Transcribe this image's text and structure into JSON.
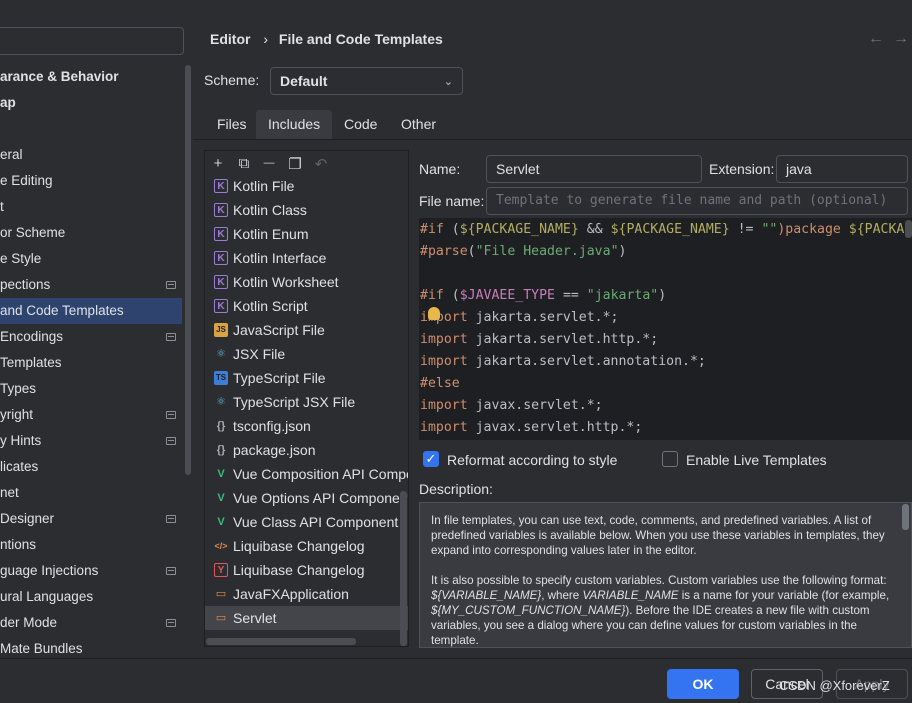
{
  "header": {
    "breadcrumb_root": "Editor",
    "breadcrumb_sep": "›",
    "breadcrumb_page": "File and Code Templates",
    "back_arrow": "←",
    "forward_arrow": "→"
  },
  "sidebar": {
    "items": [
      {
        "label": "arance & Behavior",
        "bold": true
      },
      {
        "label": "ap",
        "bold": true
      },
      {
        "label": ""
      },
      {
        "label": "eral"
      },
      {
        "label": "e Editing"
      },
      {
        "label": "t"
      },
      {
        "label": "or Scheme"
      },
      {
        "label": "e Style"
      },
      {
        "label": "pections",
        "badge": true
      },
      {
        "label": " and Code Templates",
        "selected": true
      },
      {
        "label": "Encodings",
        "badge": true
      },
      {
        "label": " Templates"
      },
      {
        "label": "Types"
      },
      {
        "label": "yright",
        "badge": true
      },
      {
        "label": "y Hints",
        "badge": true
      },
      {
        "label": "licates"
      },
      {
        "label": "net"
      },
      {
        "label": " Designer",
        "badge": true
      },
      {
        "label": "ntions"
      },
      {
        "label": "guage Injections",
        "badge": true
      },
      {
        "label": "ural Languages"
      },
      {
        "label": "der Mode",
        "badge": true
      },
      {
        "label": "Mate Bundles"
      }
    ]
  },
  "scheme": {
    "label": "Scheme:",
    "value": "Default"
  },
  "tabs": [
    {
      "label": "Files"
    },
    {
      "label": "Includes",
      "active": true
    },
    {
      "label": "Code"
    },
    {
      "label": "Other"
    }
  ],
  "toolbar": {
    "add": "+",
    "copy": "⧉",
    "remove": "—",
    "duplicate": "❐",
    "reset": "↶"
  },
  "templates": [
    {
      "label": "Kotlin File",
      "icon": "kotlin-icon",
      "glyph": "K",
      "color": "#9d7cd8"
    },
    {
      "label": "Kotlin Class",
      "icon": "kotlin-icon",
      "glyph": "K",
      "color": "#9d7cd8"
    },
    {
      "label": "Kotlin Enum",
      "icon": "kotlin-icon",
      "glyph": "K",
      "color": "#9d7cd8"
    },
    {
      "label": "Kotlin Interface",
      "icon": "kotlin-icon",
      "glyph": "K",
      "color": "#9d7cd8"
    },
    {
      "label": "Kotlin Worksheet",
      "icon": "kotlin-icon",
      "glyph": "K",
      "color": "#9d7cd8"
    },
    {
      "label": "Kotlin Script",
      "icon": "kotlin-icon",
      "glyph": "K",
      "color": "#9d7cd8"
    },
    {
      "label": "JavaScript File",
      "icon": "javascript-icon",
      "glyph": "JS",
      "color": "#d9a343"
    },
    {
      "label": "JSX File",
      "icon": "react-icon",
      "glyph": "⚛",
      "color": "#6fb7e3"
    },
    {
      "label": "TypeScript File",
      "icon": "typescript-icon",
      "glyph": "TS",
      "color": "#3c7fd8"
    },
    {
      "label": "TypeScript JSX File",
      "icon": "react-icon",
      "glyph": "⚛",
      "color": "#6fb7e3"
    },
    {
      "label": "tsconfig.json",
      "icon": "json-icon",
      "glyph": "{}",
      "color": "#a8adb3"
    },
    {
      "label": "package.json",
      "icon": "json-icon",
      "glyph": "{}",
      "color": "#a8adb3"
    },
    {
      "label": "Vue Composition API Compo",
      "icon": "vue-icon",
      "glyph": "V",
      "color": "#42b883"
    },
    {
      "label": "Vue Options API Component",
      "icon": "vue-icon",
      "glyph": "V",
      "color": "#42b883"
    },
    {
      "label": "Vue Class API Component",
      "icon": "vue-icon",
      "glyph": "V",
      "color": "#42b883"
    },
    {
      "label": "Liquibase Changelog",
      "icon": "xml-icon",
      "glyph": "</>",
      "color": "#e08b4f"
    },
    {
      "label": "Liquibase Changelog",
      "icon": "yaml-icon",
      "glyph": "Y",
      "color": "#e0575a"
    },
    {
      "label": "JavaFXApplication",
      "icon": "java-file-icon",
      "glyph": "▭",
      "color": "#e08b4f"
    },
    {
      "label": "Servlet",
      "icon": "java-file-icon",
      "glyph": "▭",
      "color": "#e08b4f",
      "selected": true
    }
  ],
  "form": {
    "name_label": "Name:",
    "name_value": "Servlet",
    "extension_label": "Extension:",
    "extension_value": "java",
    "filename_label": "File name:",
    "filename_placeholder": "Template to generate file name and path (optional)"
  },
  "code_lines": [
    [
      {
        "t": "#if",
        "c": "kw"
      },
      {
        "t": " ("
      },
      {
        "t": "${PACKAGE_NAME}",
        "c": "dir"
      },
      {
        "t": " && "
      },
      {
        "t": "${PACKAGE_NAME}",
        "c": "dir"
      },
      {
        "t": " != "
      },
      {
        "t": "\"\"",
        "c": "str"
      },
      {
        "t": ")package ",
        "c": "kw"
      },
      {
        "t": "${PACKAGE_NAME}",
        "c": "dir"
      }
    ],
    [
      {
        "t": "#parse",
        "c": "kw"
      },
      {
        "t": "("
      },
      {
        "t": "\"File Header.java\"",
        "c": "str"
      },
      {
        "t": ")"
      }
    ],
    [],
    [
      {
        "t": "#if",
        "c": "kw"
      },
      {
        "t": " ("
      },
      {
        "t": "$JAVAEE_TYPE",
        "c": "var"
      },
      {
        "t": " == "
      },
      {
        "t": "\"jakarta\"",
        "c": "str"
      },
      {
        "t": ")"
      }
    ],
    [
      {
        "t": "import",
        "c": "kw"
      },
      {
        "t": " jakarta.servlet.*;"
      }
    ],
    [
      {
        "t": "import",
        "c": "kw"
      },
      {
        "t": " jakarta.servlet.http.*;"
      }
    ],
    [
      {
        "t": "import",
        "c": "kw"
      },
      {
        "t": " jakarta.servlet.annotation.*;"
      }
    ],
    [
      {
        "t": "#else",
        "c": "kw"
      }
    ],
    [
      {
        "t": "import",
        "c": "kw"
      },
      {
        "t": " javax.servlet.*;"
      }
    ],
    [
      {
        "t": "import",
        "c": "kw"
      },
      {
        "t": " javax.servlet.http.*;"
      }
    ]
  ],
  "options": {
    "reformat_label": "Reformat according to style",
    "reformat_checked": true,
    "live_templates_label": "Enable Live Templates",
    "live_templates_checked": false
  },
  "description": {
    "label": "Description:",
    "p1": "In file templates, you can use text, code, comments, and predefined variables. A list of predefined variables is available below. When you use these variables in templates, they expand into corresponding values later in the editor.",
    "p2_a": "It is also possible to specify custom variables. Custom variables use the following format: ",
    "p2_b": "${VARIABLE_NAME}",
    "p2_c": ", where ",
    "p2_d": "VARIABLE_NAME",
    "p2_e": " is a name for your variable (for example, ",
    "p2_f": "${MY_CUSTOM_FUNCTION_NAME}",
    "p2_g": "). Before the IDE creates a new file with custom variables, you see a dialog where you can define values for custom variables in the template."
  },
  "footer": {
    "ok": "OK",
    "cancel": "Cancel",
    "apply": "Apply",
    "watermark": "CSDN @XforeverZ"
  }
}
